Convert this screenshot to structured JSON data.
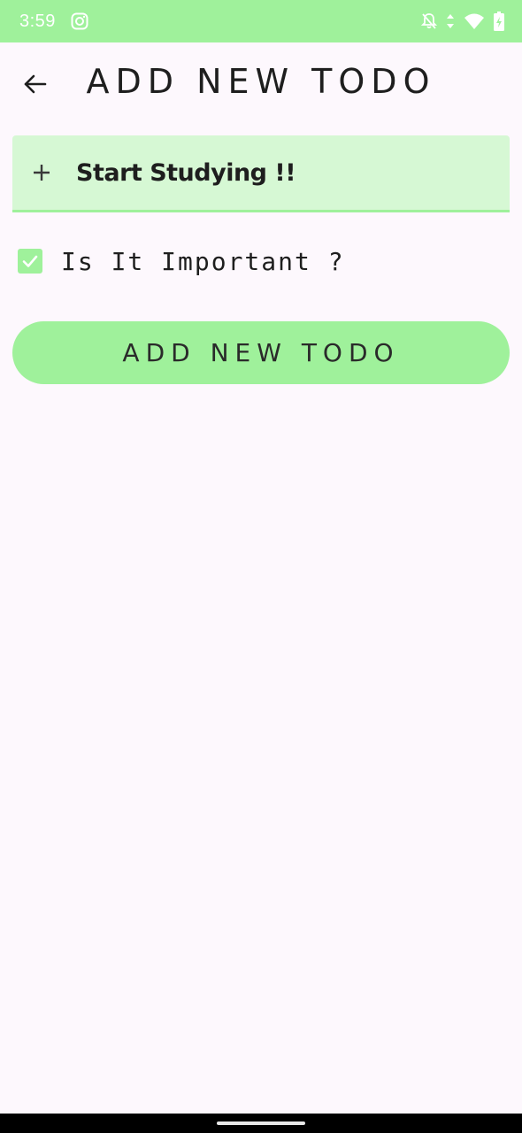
{
  "status_bar": {
    "time": "3:59",
    "icons": [
      "instagram-icon",
      "notifications-off-icon",
      "data-arrows-icon",
      "wifi-icon",
      "battery-icon"
    ],
    "background": "#9ff19b"
  },
  "app_bar": {
    "title": "ADD NEW TODO",
    "back_icon": "arrow-back-icon"
  },
  "todo_input": {
    "value": "Start Studying !!",
    "leading_icon": "plus-icon",
    "background": "#d6f8d4",
    "indicator_color": "#9ff19b"
  },
  "important": {
    "label": "Is It Important ?",
    "checked": true,
    "color": "#9ff19b"
  },
  "submit": {
    "label": "ADD NEW TODO",
    "color": "#9ff19b"
  },
  "colors": {
    "background": "#fdf8fd",
    "text": "#1e1e1e",
    "accent": "#9ff19b"
  }
}
